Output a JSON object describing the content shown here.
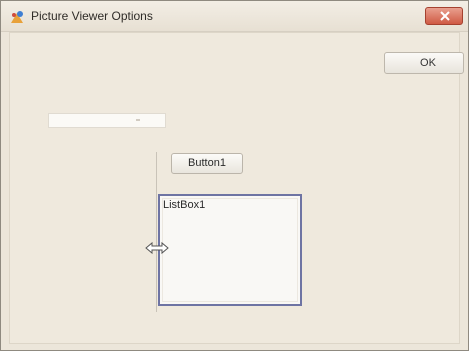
{
  "window": {
    "title": "Picture Viewer Options"
  },
  "buttons": {
    "ok_label": "OK",
    "button1_label": "Button1"
  },
  "listbox": {
    "label": "ListBox1"
  },
  "textbox": {
    "value": ""
  },
  "colors": {
    "accent": "#6e74a3",
    "close": "#cf5a44"
  },
  "icons": {
    "app": "app-icon",
    "close": "close-icon",
    "resize": "move-arrow-icon"
  }
}
